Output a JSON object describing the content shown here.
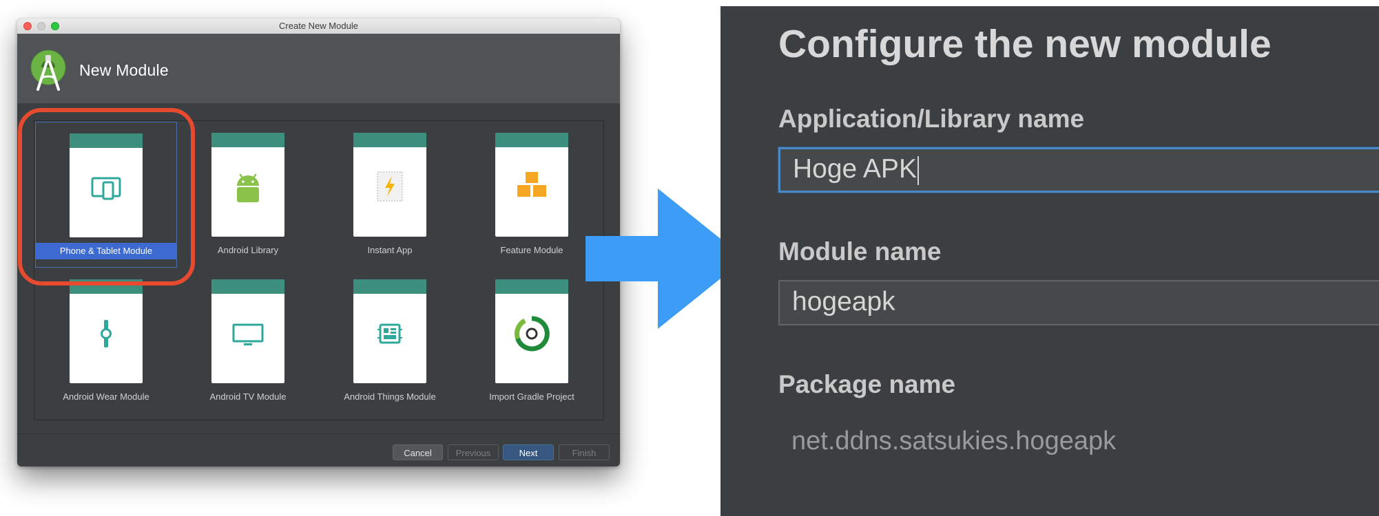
{
  "dialog": {
    "window_title": "Create New Module",
    "header_title": "New Module",
    "modules": [
      {
        "label": "Phone & Tablet Module",
        "icon": "phone-tablet-icon",
        "selected": true
      },
      {
        "label": "Android Library",
        "icon": "android-robot-icon",
        "selected": false
      },
      {
        "label": "Instant App",
        "icon": "instant-app-bolt-icon",
        "selected": false
      },
      {
        "label": "Feature Module",
        "icon": "boxes-icon",
        "selected": false
      },
      {
        "label": "Android Wear Module",
        "icon": "watch-icon",
        "selected": false
      },
      {
        "label": "Android TV Module",
        "icon": "tv-icon",
        "selected": false
      },
      {
        "label": "Android Things Module",
        "icon": "chip-icon",
        "selected": false
      },
      {
        "label": "Import Gradle Project",
        "icon": "gradle-icon",
        "selected": false
      }
    ],
    "buttons": {
      "cancel": "Cancel",
      "previous": "Previous",
      "next": "Next",
      "finish": "Finish"
    }
  },
  "configure": {
    "title": "Configure the new module",
    "app_name_label": "Application/Library name",
    "app_name_value": "Hoge APK",
    "module_name_label": "Module name",
    "module_name_value": "hogeapk",
    "package_name_label": "Package name",
    "package_name_value": "net.ddns.satsukies.hogeapk"
  },
  "colors": {
    "dialog_bg": "#3c3f41",
    "header_bg": "#505356",
    "card_accent": "#3b8f7c",
    "selection": "#3d6ad1",
    "highlight_ring": "#e84a2f",
    "arrow": "#3d9cf5",
    "focus_border": "#4a88c7"
  }
}
